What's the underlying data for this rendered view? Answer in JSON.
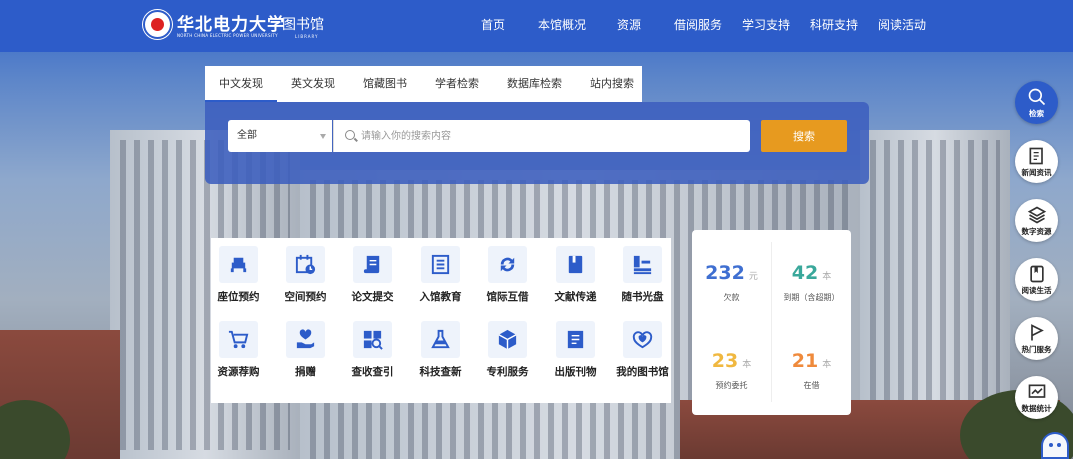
{
  "colors": {
    "brand": "#2d5cc9",
    "search_button": "#e79a1f",
    "stat_blue": "#3f6fd1",
    "stat_teal": "#3aa89b",
    "stat_yellow": "#f0b840",
    "stat_orange": "#ef8a3c"
  },
  "header": {
    "logo_cn": "华北电力大学",
    "logo_en": "NORTH CHINA ELECTRIC POWER UNIVERSITY",
    "library_title": "图书馆",
    "library_subtitle": "LIBRARY",
    "nav": [
      "首页",
      "本馆概况",
      "资源",
      "借阅服务",
      "学习支持",
      "科研支持",
      "阅读活动"
    ]
  },
  "search": {
    "tabs": [
      "中文发现",
      "英文发现",
      "馆藏图书",
      "学者检索",
      "数据库检索",
      "站内搜索"
    ],
    "active_tab": "中文发现",
    "scope": "全部",
    "placeholder": "请输入你的搜索内容",
    "button": "搜索"
  },
  "services": [
    {
      "label": "座位预约",
      "icon": "seat-icon"
    },
    {
      "label": "空间预约",
      "icon": "calendar-clock-icon"
    },
    {
      "label": "论文提交",
      "icon": "scroll-icon"
    },
    {
      "label": "入馆教育",
      "icon": "list-doc-icon"
    },
    {
      "label": "馆际互借",
      "icon": "refresh-icon"
    },
    {
      "label": "文献传递",
      "icon": "book-icon"
    },
    {
      "label": "随书光盘",
      "icon": "disc-stack-icon"
    },
    {
      "label": "资源荐购",
      "icon": "cart-icon"
    },
    {
      "label": "捐赠",
      "icon": "heart-hand-icon"
    },
    {
      "label": "查收查引",
      "icon": "search-doc-icon"
    },
    {
      "label": "科技查新",
      "icon": "flask-icon"
    },
    {
      "label": "专利服务",
      "icon": "cube-icon"
    },
    {
      "label": "出版刊物",
      "icon": "journal-icon"
    },
    {
      "label": "我的图书馆",
      "icon": "heart-shield-icon"
    }
  ],
  "stats": [
    {
      "value": "232",
      "unit": "元",
      "caption": "欠款"
    },
    {
      "value": "42",
      "unit": "本",
      "caption": "到期（含超期）"
    },
    {
      "value": "23",
      "unit": "本",
      "caption": "预约委托"
    },
    {
      "value": "21",
      "unit": "本",
      "caption": "在借"
    }
  ],
  "side_menu": [
    {
      "label": "检索",
      "icon": "search-icon"
    },
    {
      "label": "新闻资讯",
      "icon": "news-icon"
    },
    {
      "label": "数字资源",
      "icon": "layers-icon"
    },
    {
      "label": "阅读生活",
      "icon": "reading-icon"
    },
    {
      "label": "热门服务",
      "icon": "flag-icon"
    },
    {
      "label": "数据统计",
      "icon": "chart-icon"
    }
  ]
}
